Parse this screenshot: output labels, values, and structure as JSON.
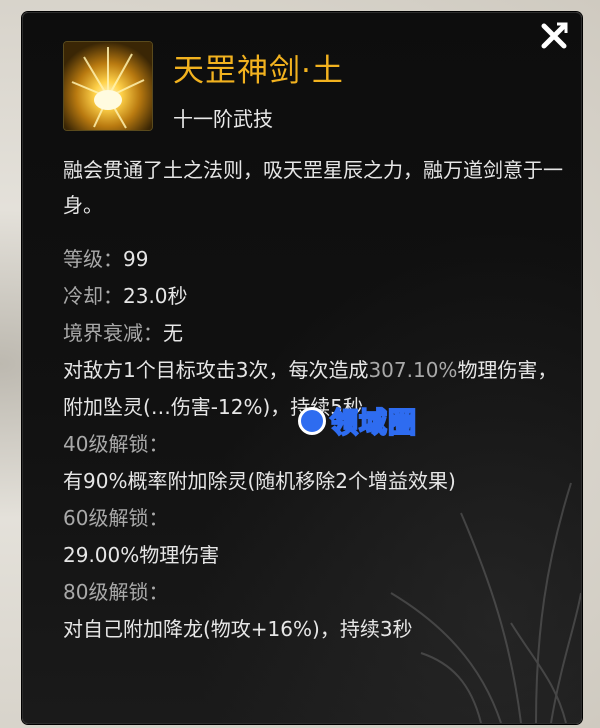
{
  "dialog": {
    "title": "天罡神剑·土",
    "subtitle": "十一阶武技",
    "description": "融会贯通了土之法则，吸天罡星辰之力，融万道剑意于一身。",
    "level_label": "等级：",
    "level_value": "99",
    "cooldown_label": "冷却：",
    "cooldown_value": "23.0秒",
    "decay_label": "境界衰减：",
    "decay_value": "无",
    "effect_prefix": "对敌方1个目标攻击3次，每次造成",
    "effect_percent": "307.10%",
    "effect_suffix": "物理伤害，附加坠灵(",
    "effect_hidden_middle": "…",
    "effect_tail": "伤害-12%)，持续5秒",
    "unlock40_label": "40级解锁：",
    "unlock40_text": "有90%概率附加除灵(随机移除2个增益效果)",
    "unlock60_label": "60级解锁：",
    "unlock60_text": "29.00%物理伤害",
    "unlock80_label": "80级解锁：",
    "unlock80_text": "对自己附加降龙(物攻+16%)，持续3秒",
    "close_icon": "close-x-icon",
    "skill_icon": "golden-sword-burst-icon"
  },
  "watermark": {
    "text": "领域圈"
  },
  "colors": {
    "title": "#f2b21f",
    "panel_bg": "#0d0d0d",
    "text": "#e6e6e6",
    "label_grey": "#a9a9a9",
    "watermark_blue": "#2e6cf0"
  }
}
